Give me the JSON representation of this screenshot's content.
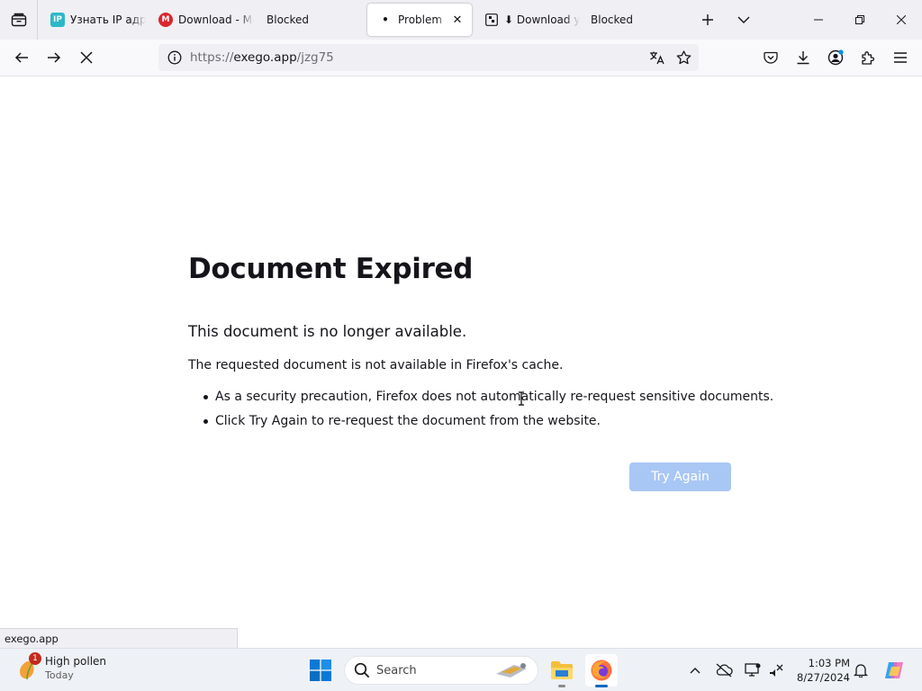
{
  "tabs": [
    {
      "title": "Узнать IP адрес",
      "favicon": "ip-favicon",
      "favicon_text": "IP",
      "favicon_color": "#2cb8c9",
      "active": false
    },
    {
      "title": "Download - Mega",
      "favicon": "mega-favicon",
      "favicon_text": "M",
      "favicon_color": "#d9272e",
      "active": false
    },
    {
      "title": "Blocked",
      "favicon": "none",
      "active": false
    },
    {
      "title": "Problem loading page",
      "favicon": "loading-favicon",
      "active": true
    },
    {
      "title": "⬇ Download your file",
      "favicon": "page-favicon",
      "active": false
    },
    {
      "title": "Blocked",
      "favicon": "none",
      "active": false
    }
  ],
  "urlbar": {
    "scheme": "https://",
    "domain": "exego.app",
    "path": "/jzg75"
  },
  "error_page": {
    "title": "Document Expired",
    "short_desc": "This document is no longer available.",
    "long_desc": "The requested document is not available in Firefox's cache.",
    "bullets": [
      "As a security precaution, Firefox does not automatically re-request sensitive documents.",
      "Click Try Again to re-request the document from the website."
    ],
    "button_label": "Try Again",
    "button_color": "#a9c7f4"
  },
  "status_panel": {
    "text": "exego.app"
  },
  "taskbar": {
    "weather": {
      "title": "High pollen",
      "subtitle": "Today",
      "badge": "1"
    },
    "search_label": "Search",
    "clock": {
      "time": "1:03 PM",
      "date": "8/27/2024"
    }
  },
  "colors": {
    "accent": "#0061e0",
    "tabbar_bg": "#f0f0f4",
    "taskbar_bg": "#eef1f6"
  }
}
